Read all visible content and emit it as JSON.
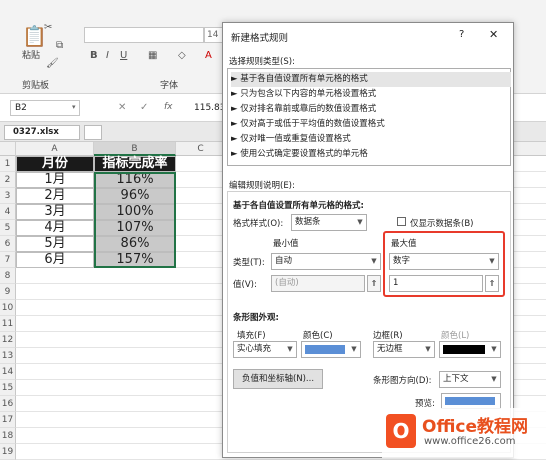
{
  "ribbon": {
    "paste_label": "粘贴",
    "font_size": "14",
    "bold": "B",
    "italic": "I",
    "underline": "U",
    "clipboard_label": "剪贴板",
    "font_label": "字体"
  },
  "formula_bar": {
    "name_box": "B2",
    "fx": "fx",
    "value": "115.83"
  },
  "workbook_tab": "0327.xlsx",
  "columns": [
    "A",
    "B",
    "C"
  ],
  "rows": [
    "1",
    "2",
    "3",
    "4",
    "5",
    "6",
    "7",
    "8",
    "9",
    "10",
    "11",
    "12",
    "13",
    "14",
    "15",
    "16",
    "17",
    "18",
    "19"
  ],
  "table": {
    "headers": [
      "月份",
      "指标完成率"
    ],
    "data": [
      [
        "1月",
        "116%"
      ],
      [
        "2月",
        "96%"
      ],
      [
        "3月",
        "100%"
      ],
      [
        "4月",
        "107%"
      ],
      [
        "5月",
        "86%"
      ],
      [
        "6月",
        "157%"
      ]
    ]
  },
  "dialog": {
    "title": "新建格式规则",
    "help": "?",
    "close": "✕",
    "rule_type_label": "选择规则类型(S):",
    "rule_types": [
      "► 基于各自值设置所有单元格的格式",
      "► 只为包含以下内容的单元格设置格式",
      "► 仅对排名靠前或靠后的数值设置格式",
      "► 仅对高于或低于平均值的数值设置格式",
      "► 仅对唯一值或重复值设置格式",
      "► 使用公式确定要设置格式的单元格"
    ],
    "edit_desc_label": "编辑规则说明(E):",
    "based_on_label": "基于各自值设置所有单元格的格式:",
    "format_style_label": "格式样式(O):",
    "format_style_value": "数据条",
    "show_bar_only": "仅显示数据条(B)",
    "min_label": "最小值",
    "max_label": "最大值",
    "type_label": "类型(T):",
    "value_label": "值(V):",
    "min_type": "自动",
    "max_type": "数字",
    "min_value": "(自动)",
    "max_value": "1",
    "bar_appearance_label": "条形图外观:",
    "fill_label": "填充(F)",
    "color_label": "颜色(C)",
    "border_label": "边框(R)",
    "border_color_label": "颜色(L)",
    "fill_value": "实心填充",
    "border_value": "无边框",
    "fill_color": "#5b8fd6",
    "border_color": "#000000",
    "neg_axis_button": "负值和坐标轴(N)...",
    "direction_label": "条形图方向(D):",
    "direction_value": "上下文",
    "preview_label": "预览:"
  },
  "watermark": {
    "brand": "Office教程网",
    "url": "www.office26.com"
  },
  "colors": {
    "header_bg": "#1a1a1a",
    "header_text": "#ffffff",
    "selected_bg": "#c9c9c9",
    "highlight_red": "#e83a2b",
    "logo_orange": "#f25022"
  }
}
